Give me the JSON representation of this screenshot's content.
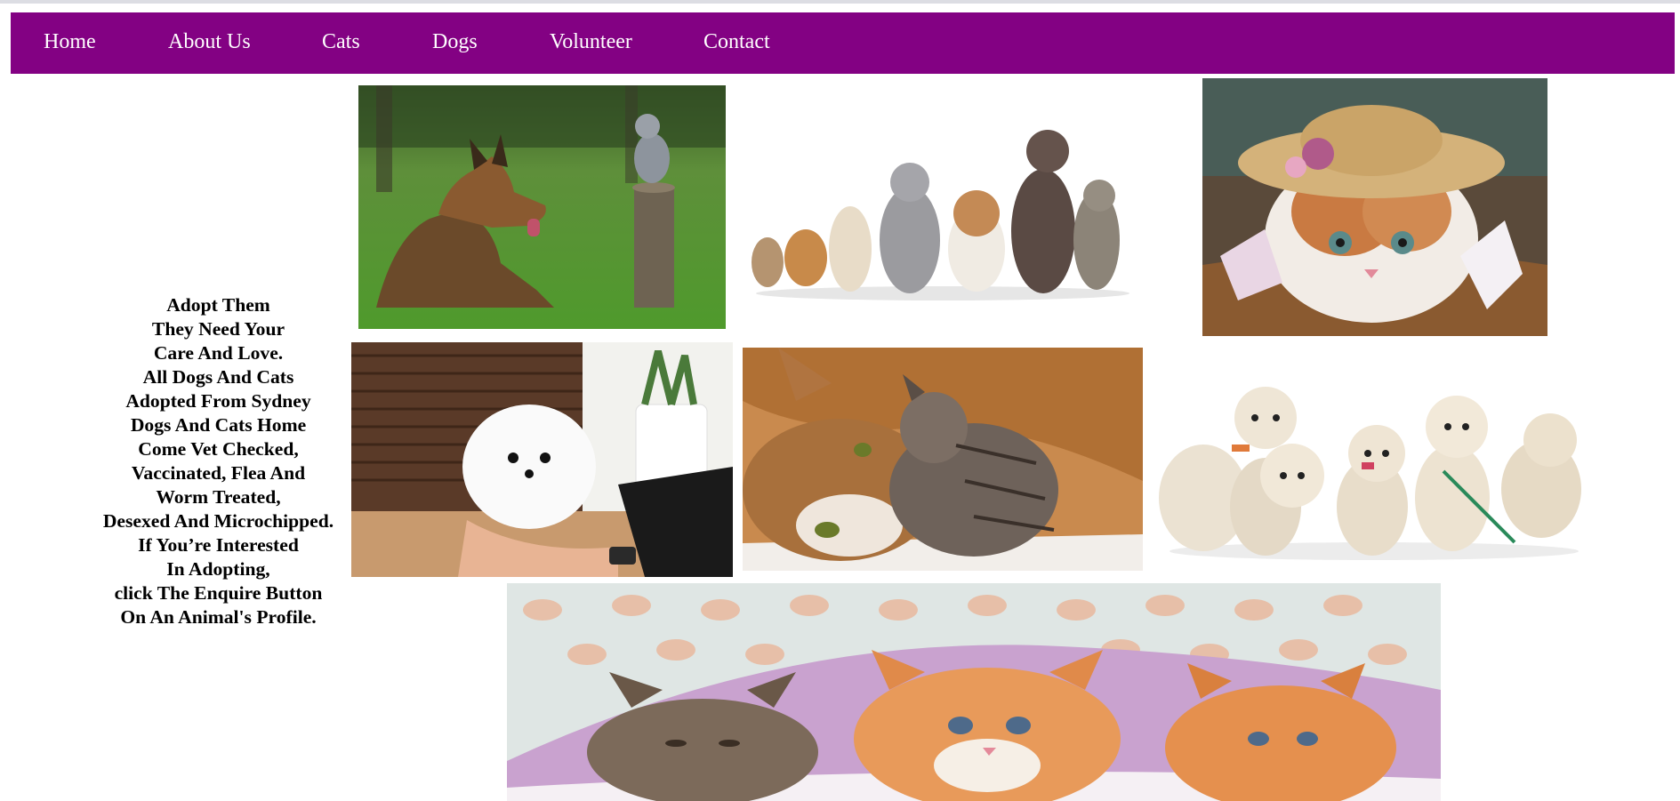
{
  "nav": {
    "items": [
      "Home",
      "About Us",
      "Cats",
      "Dogs",
      "Volunteer",
      "Contact"
    ],
    "background": "#830183",
    "text_color": "#ffffff"
  },
  "intro": {
    "lines": [
      "Adopt Them",
      "They Need Your",
      "Care And Love.",
      "All Dogs And Cats",
      "Adopted From Sydney",
      "Dogs And Cats Home",
      "Come Vet Checked,",
      "Vaccinated, Flea And",
      "Worm Treated,",
      "Desexed And Microchipped.",
      "If You’re Interested",
      "In Adopting,",
      "click The Enquire Button",
      "On An Animal's Profile."
    ]
  },
  "gallery": {
    "photos": [
      {
        "name": "photo-dog-and-kitten-on-stump"
      },
      {
        "name": "photo-group-of-cats-and-dogs"
      },
      {
        "name": "photo-kitten-in-straw-hat"
      },
      {
        "name": "photo-white-pomeranian-puppy"
      },
      {
        "name": "photo-cat-with-kitten"
      },
      {
        "name": "photo-golden-retriever-puppies"
      },
      {
        "name": "photo-three-kittens-under-blanket"
      }
    ]
  }
}
